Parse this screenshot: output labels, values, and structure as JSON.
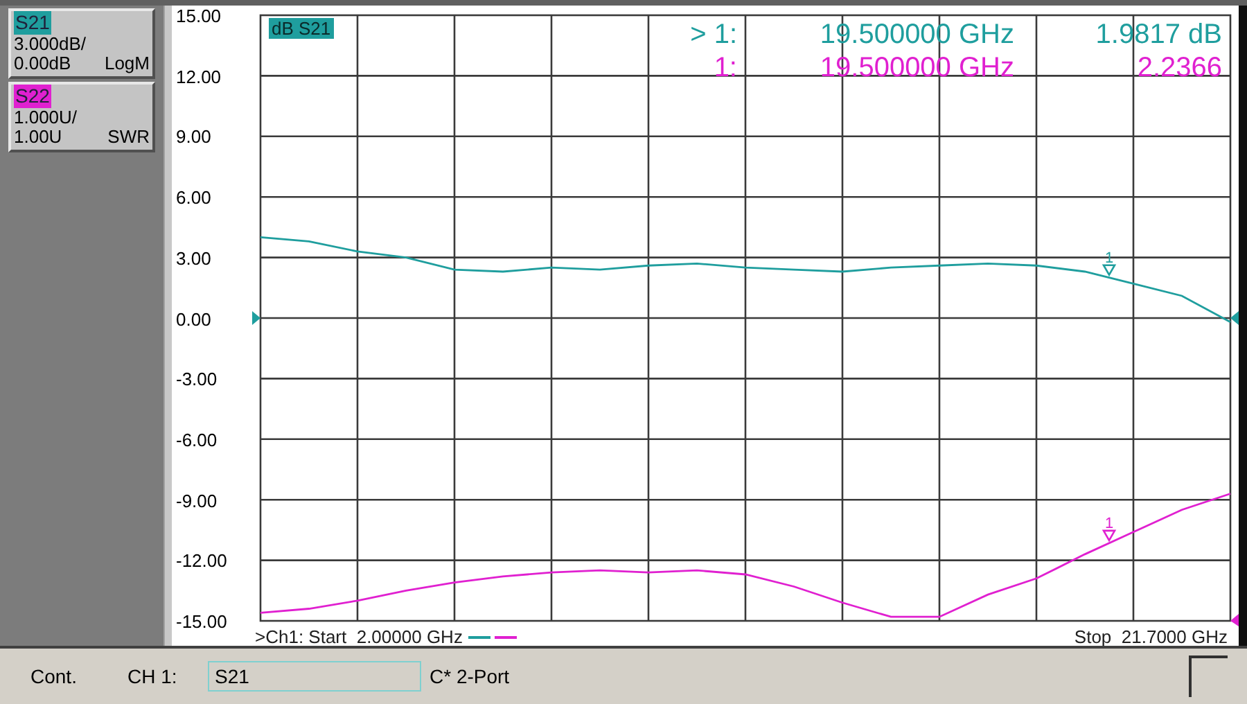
{
  "trace_panel": [
    {
      "name": "S21",
      "color": "#1f9e9e",
      "scale": "3.000dB/",
      "reference": "0.00dB",
      "format": "LogM"
    },
    {
      "name": "S22",
      "color": "#e020d0",
      "scale": "1.000U/",
      "reference": "1.00U",
      "format": "SWR"
    }
  ],
  "plot": {
    "trace_label": "dB S21",
    "marker_readout": [
      {
        "marker": "> 1:",
        "frequency": "19.500000 GHz",
        "value": "1.9817 dB",
        "color": "#1f9e9e"
      },
      {
        "marker": "1:",
        "frequency": "19.500000 GHz",
        "value": "2.2366",
        "color": "#e020d0"
      }
    ],
    "marker_flags": [
      {
        "label": "1",
        "color": "#1f9e9e"
      },
      {
        "label": "1",
        "color": "#e020d0"
      }
    ],
    "start": ">Ch1: Start  2.00000 GHz",
    "stop": "Stop  21.7000 GHz",
    "chart_data": {
      "type": "line",
      "categories": [
        null,
        null,
        null,
        null,
        null,
        null,
        null,
        null,
        null,
        null,
        null,
        null,
        null,
        null,
        null,
        null,
        null,
        null,
        null,
        null,
        null
      ],
      "series": [
        {
          "color": "#1f9e9e",
          "values": [
            4.0,
            3.8,
            3.3,
            3.0,
            2.4,
            2.3,
            2.5,
            2.4,
            2.6,
            2.7,
            2.5,
            2.4,
            2.3,
            2.5,
            2.6,
            2.7,
            2.6,
            2.3,
            1.7,
            1.1,
            -0.2
          ]
        },
        {
          "color": "#e020d0",
          "values": [
            -14.6,
            -14.4,
            -14.0,
            -13.5,
            -13.1,
            -12.8,
            -12.6,
            -12.5,
            -12.6,
            -12.5,
            -12.7,
            -13.3,
            -14.1,
            -14.8,
            -14.8,
            -13.7,
            -12.9,
            -11.7,
            -10.6,
            -9.5,
            -8.7
          ]
        }
      ],
      "ylim": [
        -15,
        15
      ],
      "grid": true,
      "yticks": [
        {
          "value": 15,
          "label": "15.00"
        },
        {
          "value": 12,
          "label": "12.00"
        },
        {
          "value": 9,
          "label": "9.00"
        },
        {
          "value": 6,
          "label": "6.00"
        },
        {
          "value": 3,
          "label": "3.00"
        },
        {
          "value": 0,
          "label": "0.00"
        },
        {
          "value": -3,
          "label": "-3.00"
        },
        {
          "value": -6,
          "label": "-6.00"
        },
        {
          "value": -9,
          "label": "-9.00"
        },
        {
          "value": -12,
          "label": "-12.00"
        },
        {
          "value": -15,
          "label": "-15.00"
        }
      ]
    }
  },
  "status_bar": {
    "mode": "Cont.",
    "channel": "CH 1:",
    "parameter": "S21",
    "calibration": "C* 2-Port"
  }
}
